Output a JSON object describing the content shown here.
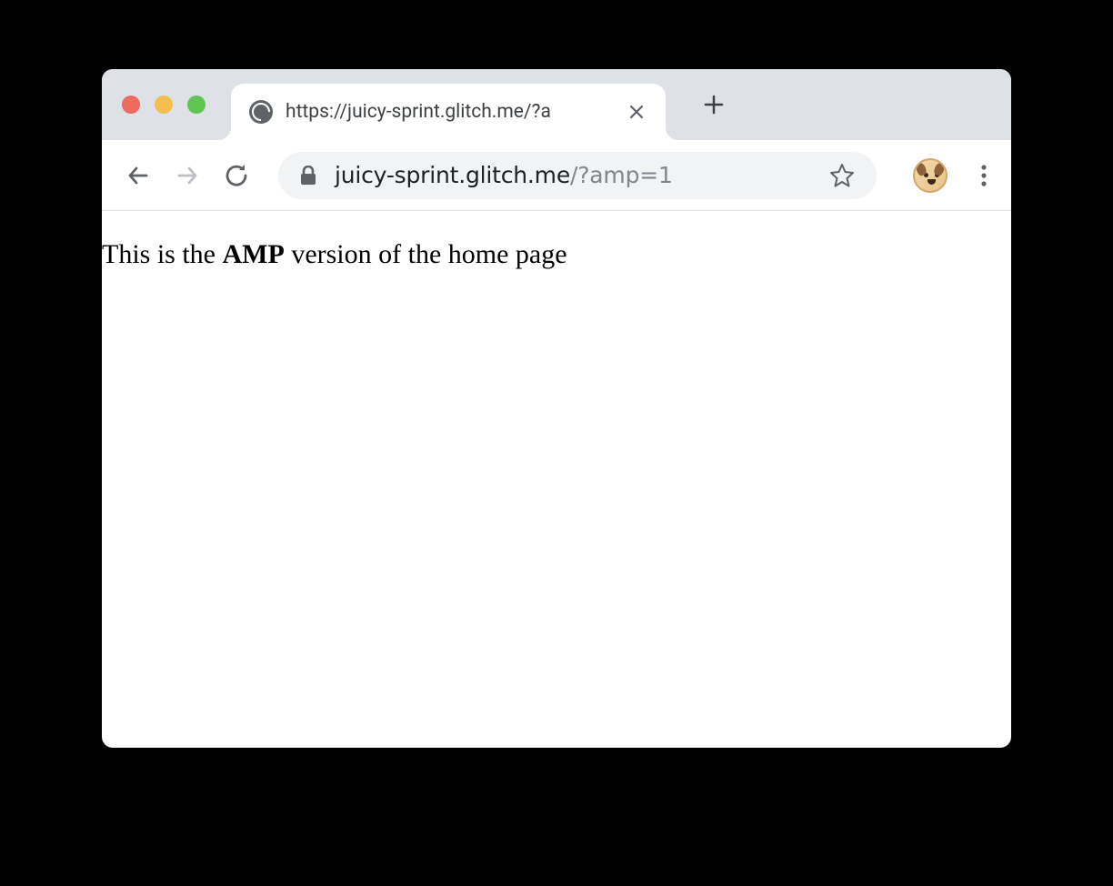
{
  "tab": {
    "title": "https://juicy-sprint.glitch.me/?a"
  },
  "address": {
    "host": "juicy-sprint.glitch.me",
    "query": "/?amp=1"
  },
  "page": {
    "text_before": "This is the ",
    "text_bold": "AMP",
    "text_after": " version of the home page"
  }
}
